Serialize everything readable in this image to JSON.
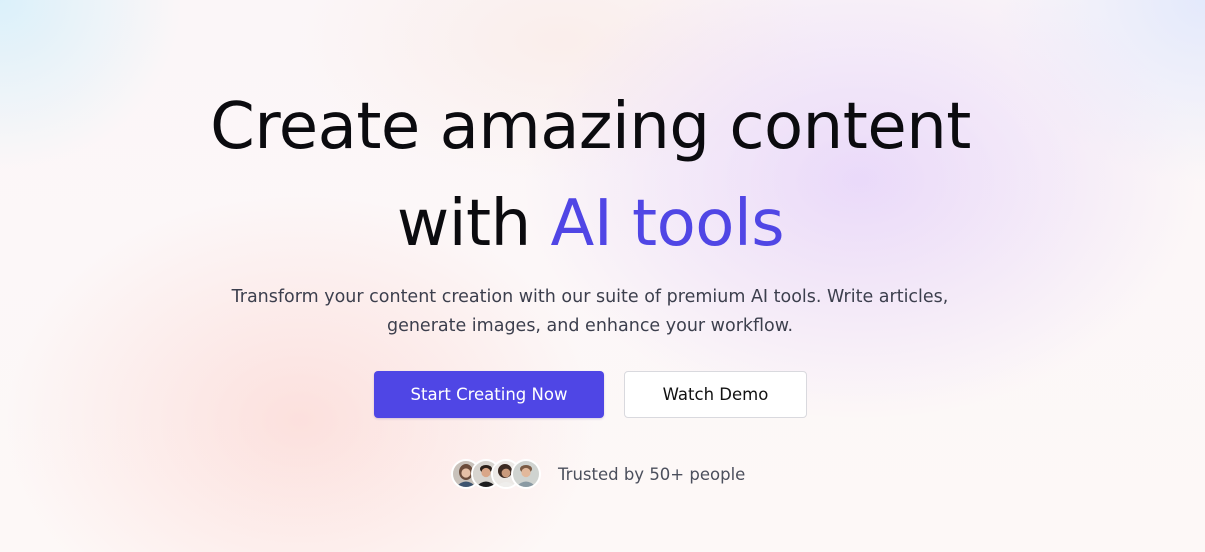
{
  "hero": {
    "headline_line1": "Create amazing content",
    "headline_line2_prefix": "with ",
    "headline_line2_accent": "AI tools",
    "subtext_line1": "Transform your content creation with our suite of premium AI tools. Write articles,",
    "subtext_line2": "generate images, and enhance your workflow.",
    "primary_button": "Start Creating Now",
    "secondary_button": "Watch Demo",
    "trust_text": "Trusted by 50+ people",
    "avatars": [
      "user-avatar-1",
      "user-avatar-2",
      "user-avatar-3",
      "user-avatar-4"
    ]
  },
  "colors": {
    "accent": "#4f46e5",
    "headline": "#0b0b0f",
    "subtext": "#3c3f4d"
  }
}
